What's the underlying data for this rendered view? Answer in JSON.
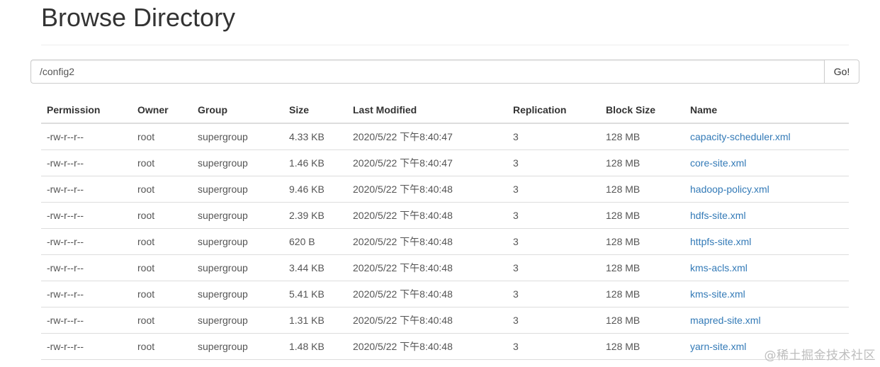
{
  "page": {
    "title": "Browse Directory"
  },
  "path_bar": {
    "value": "/config2",
    "go_label": "Go!"
  },
  "table": {
    "headers": [
      "Permission",
      "Owner",
      "Group",
      "Size",
      "Last Modified",
      "Replication",
      "Block Size",
      "Name"
    ],
    "rows": [
      {
        "permission": "-rw-r--r--",
        "owner": "root",
        "group": "supergroup",
        "size": "4.33 KB",
        "modified": "2020/5/22 下午8:40:47",
        "replication": "3",
        "block_size": "128 MB",
        "name": "capacity-scheduler.xml"
      },
      {
        "permission": "-rw-r--r--",
        "owner": "root",
        "group": "supergroup",
        "size": "1.46 KB",
        "modified": "2020/5/22 下午8:40:47",
        "replication": "3",
        "block_size": "128 MB",
        "name": "core-site.xml"
      },
      {
        "permission": "-rw-r--r--",
        "owner": "root",
        "group": "supergroup",
        "size": "9.46 KB",
        "modified": "2020/5/22 下午8:40:48",
        "replication": "3",
        "block_size": "128 MB",
        "name": "hadoop-policy.xml"
      },
      {
        "permission": "-rw-r--r--",
        "owner": "root",
        "group": "supergroup",
        "size": "2.39 KB",
        "modified": "2020/5/22 下午8:40:48",
        "replication": "3",
        "block_size": "128 MB",
        "name": "hdfs-site.xml"
      },
      {
        "permission": "-rw-r--r--",
        "owner": "root",
        "group": "supergroup",
        "size": "620 B",
        "modified": "2020/5/22 下午8:40:48",
        "replication": "3",
        "block_size": "128 MB",
        "name": "httpfs-site.xml"
      },
      {
        "permission": "-rw-r--r--",
        "owner": "root",
        "group": "supergroup",
        "size": "3.44 KB",
        "modified": "2020/5/22 下午8:40:48",
        "replication": "3",
        "block_size": "128 MB",
        "name": "kms-acls.xml"
      },
      {
        "permission": "-rw-r--r--",
        "owner": "root",
        "group": "supergroup",
        "size": "5.41 KB",
        "modified": "2020/5/22 下午8:40:48",
        "replication": "3",
        "block_size": "128 MB",
        "name": "kms-site.xml"
      },
      {
        "permission": "-rw-r--r--",
        "owner": "root",
        "group": "supergroup",
        "size": "1.31 KB",
        "modified": "2020/5/22 下午8:40:48",
        "replication": "3",
        "block_size": "128 MB",
        "name": "mapred-site.xml"
      },
      {
        "permission": "-rw-r--r--",
        "owner": "root",
        "group": "supergroup",
        "size": "1.48 KB",
        "modified": "2020/5/22 下午8:40:48",
        "replication": "3",
        "block_size": "128 MB",
        "name": "yarn-site.xml"
      }
    ]
  },
  "watermark": "@稀土掘金技术社区",
  "colors": {
    "link": "#337ab7",
    "text": "#333333",
    "muted_text": "#555555",
    "border": "#dddddd"
  }
}
